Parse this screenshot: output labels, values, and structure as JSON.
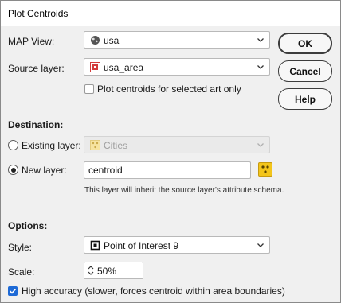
{
  "window": {
    "title": "Plot Centroids"
  },
  "map_view": {
    "label": "MAP View:",
    "value": "usa",
    "icon": "globe-icon"
  },
  "source_layer": {
    "label": "Source layer:",
    "value": "usa_area",
    "icon": "area-layer-icon"
  },
  "selected_only": {
    "label": "Plot centroids for selected art only",
    "checked": false
  },
  "buttons": {
    "ok": "OK",
    "cancel": "Cancel",
    "help": "Help"
  },
  "destination": {
    "heading": "Destination:",
    "existing": {
      "label": "Existing layer:",
      "value": "Cities",
      "selected": false,
      "enabled": false
    },
    "new": {
      "label": "New layer:",
      "value": "centroid",
      "selected": true
    },
    "note": "This layer will inherit the source layer's attribute schema."
  },
  "options": {
    "heading": "Options:",
    "style": {
      "label": "Style:",
      "value": "Point of Interest 9"
    },
    "scale": {
      "label": "Scale:",
      "value": "50%"
    },
    "high_accuracy": {
      "label": "High accuracy (slower, forces centroid within area boundaries)",
      "checked": true
    }
  },
  "colors": {
    "accent": "#1e6ad6",
    "point_icon": "#f3c51b",
    "area_icon": "#d33b3b"
  }
}
